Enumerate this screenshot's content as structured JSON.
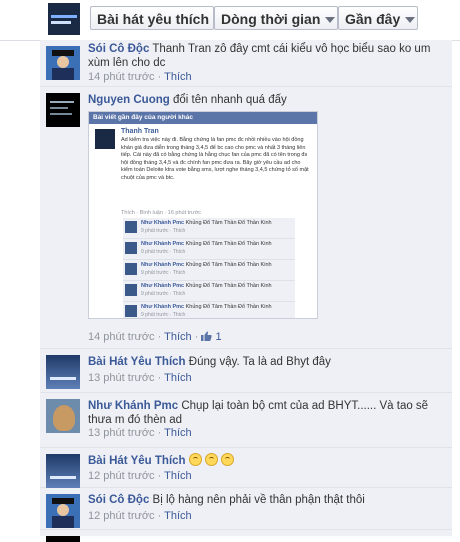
{
  "filters": [
    {
      "label": "Bài hát yêu thích",
      "dropdown": false
    },
    {
      "label": "Dòng thời gian",
      "dropdown": true
    },
    {
      "label": "Gần đây",
      "dropdown": true
    }
  ],
  "comments": [
    {
      "name": "Sói Cô Độc",
      "text": "Thanh Tran zô đây cmt cái kiểu vô học biểu sao ko um xùm lên cho dc",
      "time": "14 phút trước",
      "like": "Thích"
    },
    {
      "name": "Nguyen Cuong",
      "text": "đổi tên nhanh quá đấy",
      "time": "14 phút trước",
      "like": "Thích",
      "like_count": "1",
      "screenshot": {
        "header": "Bài viết gần đây của người khác",
        "name": "Thanh Tran",
        "text": "Ad kiểm tra việc này đi. Bằng chứng là fan pmc đc nhồi nhiều vào hội đồng khán giả đưa diễn trong tháng 3,4,5 để bc cao cho pmc và nhất 3 tháng liên tiếp. Cái này đã có bằng chứng là hằng chục fan của pmc đã có tên trong đs hội đồng tháng 3,4,5 và đc chính fan pmc đưa ra. Bây giờ yêu cầu ad cho kiểm toán Deloite ktra vote bằng sms, lượt nghe tháng 3,4,5 chứng tỏ số mặt chuột của pmc và btc.",
        "meta": "Thích · Bình luận · 16 phút trước",
        "replies": [
          {
            "name": "Như Khánh Pmc",
            "text": "Khủng",
            "tail": "Đổ Tâm Thần Đổ Thần Kinh",
            "time": "9 phút trước · Thích"
          },
          {
            "name": "Như Khánh Pmc",
            "text": "Khủng",
            "tail": "Đổ Tâm Thần Đổ Thần Kinh",
            "time": "9 phút trước · Thích"
          },
          {
            "name": "Như Khánh Pmc",
            "text": "Khủng",
            "tail": "Đổ Tâm Thần Đổ Thần Kinh",
            "time": "9 phút trước · Thích"
          },
          {
            "name": "Như Khánh Pmc",
            "text": "Khủng",
            "tail": "Đổ Tâm Thần Đổ Thần Kinh",
            "time": "9 phút trước · Thích"
          },
          {
            "name": "Như Khánh Pmc",
            "text": "Khủng",
            "tail": "Đổ Tâm Thần Đổ Thần Kinh",
            "time": "9 phút trước · Thích"
          },
          {
            "name": "Như Khánh Pmc",
            "text": "Khủng",
            "tail": "Đổ Tâm Thần Đổ Thần Kinh",
            "time": "9 phút trước · Thích"
          }
        ]
      }
    },
    {
      "name": "Bài Hát Yêu Thích",
      "text": "Đúng vậy. Ta là ad Bhyt đây",
      "time": "13 phút trước",
      "like": "Thích"
    },
    {
      "name": "Như Khánh Pmc",
      "text": "Chụp lại toàn bộ cmt của ad BHYT...... Và tao sẽ thưa m đó thèn ad",
      "time": "13 phút trước",
      "like": "Thích"
    },
    {
      "name": "Bài Hát Yêu Thích",
      "text": "",
      "time": "12 phút trước",
      "like": "Thích",
      "emoticons": 3
    },
    {
      "name": "Sói Cô Độc",
      "text": "Bị lộ hàng nên phải về thân phận thật thôi",
      "time": "12 phút trước",
      "like": "Thích"
    }
  ],
  "separator": "·"
}
